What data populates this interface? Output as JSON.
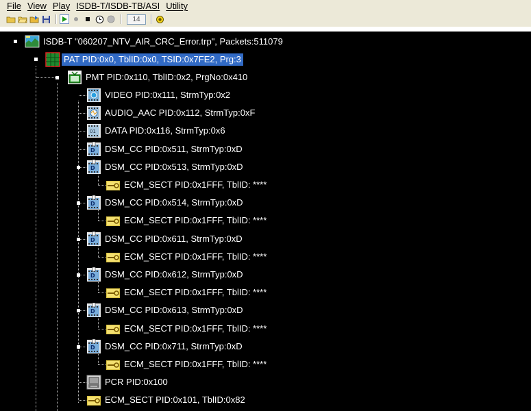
{
  "menu": [
    {
      "label": "File"
    },
    {
      "label": "View"
    },
    {
      "label": "Play"
    },
    {
      "label": "ISDB-T/ISDB-TB/ASI"
    },
    {
      "label": "Utility"
    }
  ],
  "toolbar": {
    "field_value": "14",
    "buttons": [
      "new-folder-icon",
      "open-folder-icon",
      "open-file-icon",
      "save-disk-icon",
      "play-icon",
      "record-icon",
      "stop-icon",
      "clock-icon",
      "status-dot-icon",
      "lightbulb-icon"
    ]
  },
  "colors": {
    "tree_bg": "#000000",
    "selection": "#316ac5",
    "chrome": "#ece9d8"
  },
  "tree": {
    "root": {
      "label": "ISDB-T \"060207_NTV_AIR_CRC_Error.trp\", Packets:511079",
      "icon": "transport-stream-icon"
    },
    "pat": {
      "label": "PAT PID:0x0, TblID:0x0, TSID:0x7FE2, Prg:3",
      "icon": "pat-table-icon",
      "selected": true
    },
    "pmt": {
      "label": "PMT PID:0x110, TblID:0x2, PrgNo:0x410",
      "icon": "tv-program-icon"
    },
    "streams": [
      {
        "label": "VIDEO PID:0x111, StrmTyp:0x2",
        "icon": "video-stream-icon"
      },
      {
        "label": "AUDIO_AAC PID:0x112, StrmTyp:0xF",
        "icon": "audio-stream-icon"
      },
      {
        "label": "DATA PID:0x116, StrmTyp:0x6",
        "icon": "data-stream-icon"
      },
      {
        "label": "DSM_CC PID:0x511, StrmTyp:0xD",
        "icon": "dsmcc-stream-icon"
      },
      {
        "label": "DSM_CC PID:0x513, StrmTyp:0xD",
        "icon": "dsmcc-stream-icon",
        "child": {
          "label": "ECM_SECT PID:0x1FFF, TblID: ****",
          "icon": "key-icon"
        }
      },
      {
        "label": "DSM_CC PID:0x514, StrmTyp:0xD",
        "icon": "dsmcc-stream-icon",
        "child": {
          "label": "ECM_SECT PID:0x1FFF, TblID: ****",
          "icon": "key-icon"
        }
      },
      {
        "label": "DSM_CC PID:0x611, StrmTyp:0xD",
        "icon": "dsmcc-stream-icon",
        "child": {
          "label": "ECM_SECT PID:0x1FFF, TblID: ****",
          "icon": "key-icon"
        }
      },
      {
        "label": "DSM_CC PID:0x612, StrmTyp:0xD",
        "icon": "dsmcc-stream-icon",
        "child": {
          "label": "ECM_SECT PID:0x1FFF, TblID: ****",
          "icon": "key-icon"
        }
      },
      {
        "label": "DSM_CC PID:0x613, StrmTyp:0xD",
        "icon": "dsmcc-stream-icon",
        "child": {
          "label": "ECM_SECT PID:0x1FFF, TblID: ****",
          "icon": "key-icon"
        }
      },
      {
        "label": "DSM_CC PID:0x711, StrmTyp:0xD",
        "icon": "dsmcc-stream-icon",
        "child": {
          "label": "ECM_SECT PID:0x1FFF, TblID: ****",
          "icon": "key-icon"
        }
      },
      {
        "label": "PCR PID:0x100",
        "icon": "pcr-clock-icon"
      },
      {
        "label": "ECM_SECT PID:0x101, TblID:0x82",
        "icon": "key-icon"
      }
    ]
  }
}
